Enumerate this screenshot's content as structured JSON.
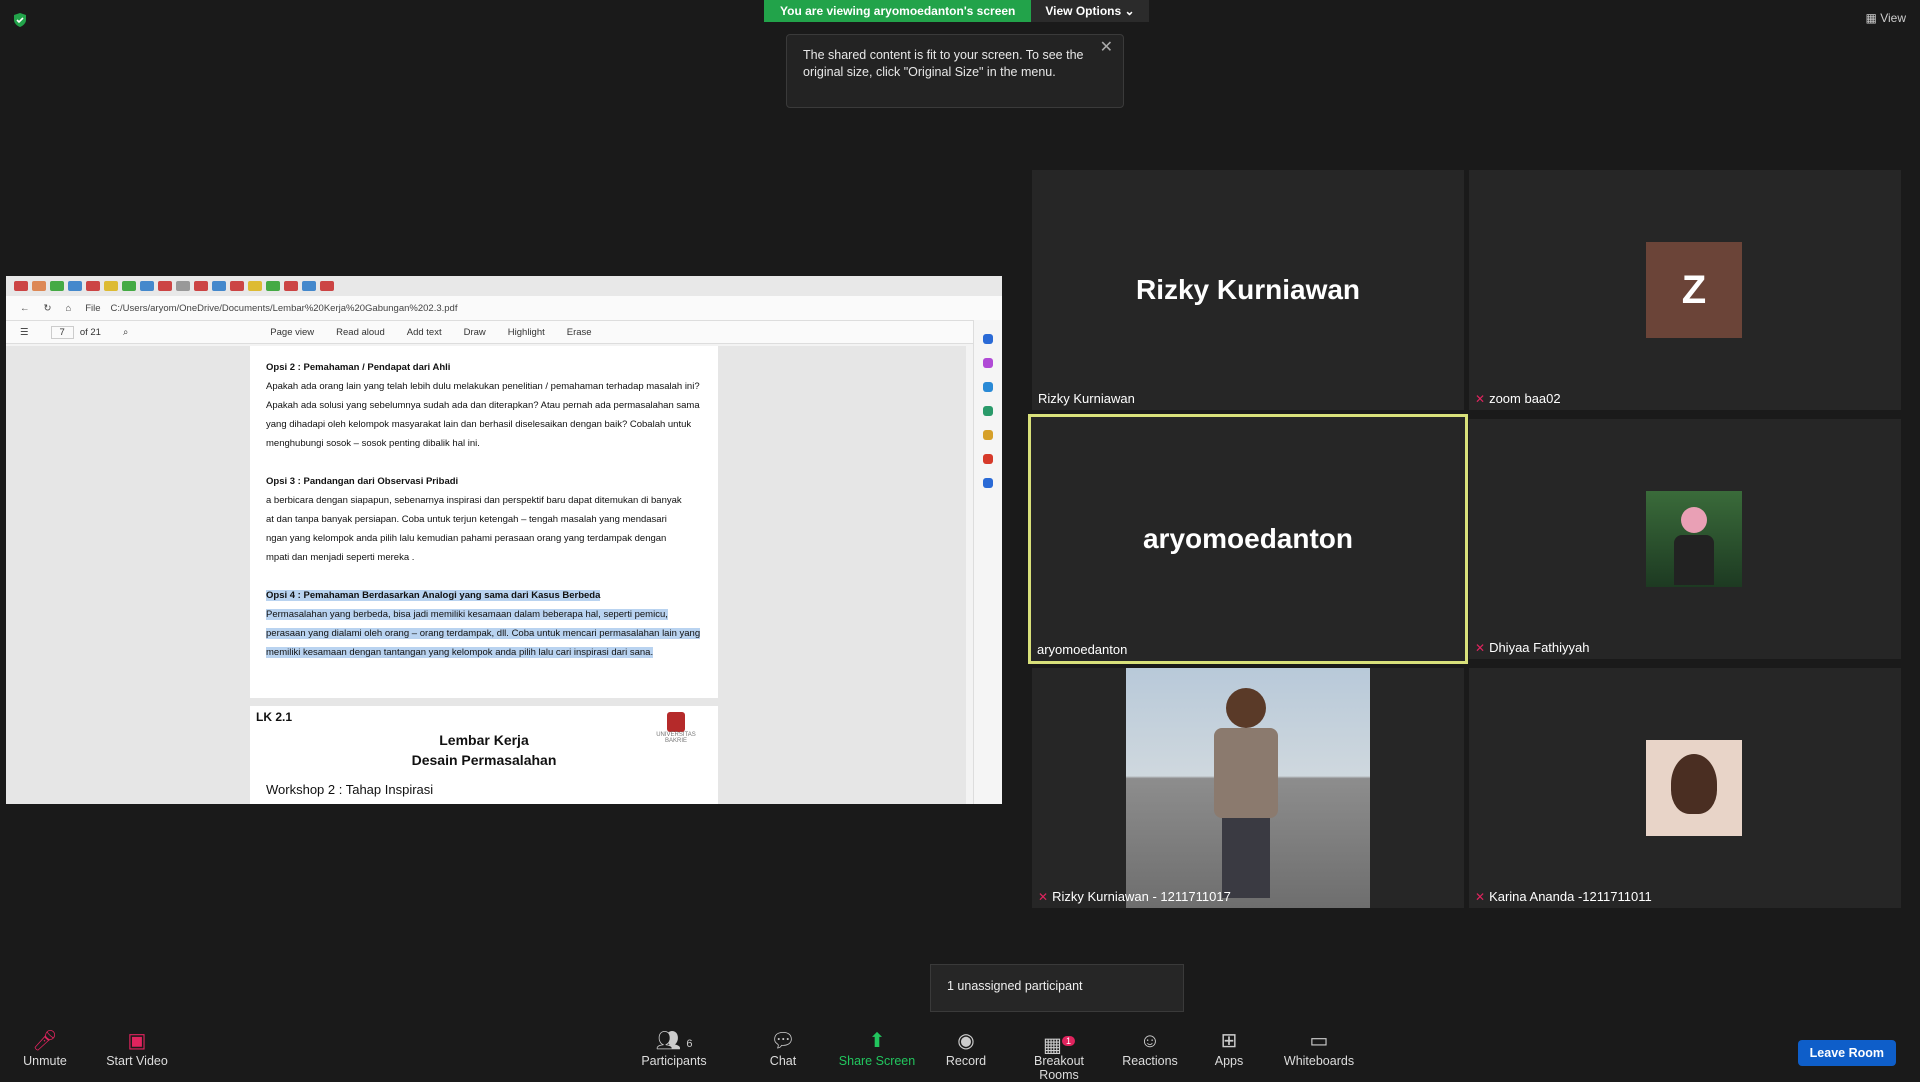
{
  "banner": {
    "viewing": "You are viewing aryomoedanton's screen",
    "view_options": "View Options"
  },
  "tooltip": {
    "text": "The shared content is fit to your screen. To see the original size, click \"Original Size\" in the menu."
  },
  "view": "View",
  "browser": {
    "path": "C:/Users/aryom/OneDrive/Documents/Lembar%20Kerja%20Gabungan%202.3.pdf",
    "file_label": "File",
    "page_current": "7",
    "page_total": "of 21",
    "tools": [
      "Page view",
      "Read aloud",
      "Add text",
      "Draw",
      "Highlight",
      "Erase"
    ]
  },
  "pdf": {
    "opsi2_title": "Opsi 2 : Pemahaman / Pendapat dari Ahli",
    "opsi2_lines": [
      "Apakah ada orang lain yang telah lebih dulu melakukan penelitian / pemahaman terhadap masalah ini?",
      "Apakah ada solusi yang sebelumnya sudah ada dan diterapkan? Atau pernah ada permasalahan sama",
      "yang dihadapi oleh kelompok masyarakat lain dan berhasil diselesaikan dengan baik? Cobalah untuk",
      "menghubungi sosok – sosok penting dibalik hal ini."
    ],
    "opsi3_title": "Opsi 3 : Pandangan dari Observasi Pribadi",
    "opsi3_lines": [
      "a berbicara dengan siapapun, sebenarnya inspirasi dan perspektif baru dapat ditemukan di banyak",
      "at dan tanpa banyak persiapan. Coba untuk terjun ketengah – tengah masalah yang mendasari",
      "ngan yang kelompok anda pilih lalu kemudian pahami perasaan orang yang terdampak dengan",
      "mpati dan menjadi seperti mereka ."
    ],
    "opsi4_title": "Opsi 4 : Pemahaman Berdasarkan Analogi yang sama dari Kasus Berbeda",
    "opsi4_lines": [
      "Permasalahan yang berbeda, bisa jadi memiliki kesamaan dalam beberapa hal, seperti pemicu,",
      "perasaan yang dialami oleh orang – orang terdampak, dll. Coba untuk mencari permasalahan lain yang",
      "memiliki kesamaan dengan tantangan yang kelompok anda pilih lalu cari inspirasi dari sana."
    ],
    "lk": "LK 2.1",
    "page2_title1": "Lembar Kerja",
    "page2_title2": "Desain Permasalahan",
    "page2_sub": "Workshop 2 : Tahap Inspirasi",
    "logo_text": "UNIVERSITAS BAKRIE"
  },
  "participants": [
    {
      "display": "Rizky Kurniawan",
      "label": "Rizky Kurniawan",
      "muted": false
    },
    {
      "display": "Z",
      "label": "zoom baa02",
      "muted": true
    },
    {
      "display": "aryomoedanton",
      "label": "aryomoedanton",
      "muted": false
    },
    {
      "display": "",
      "label": "Dhiyaa Fathiyyah",
      "muted": true
    },
    {
      "display": "",
      "label": "Rizky Kurniawan - 1211711017",
      "muted": true
    },
    {
      "display": "",
      "label": "Karina Ananda -1211711011",
      "muted": true
    }
  ],
  "unassigned": "1 unassigned participant",
  "toolbar": {
    "unmute": "Unmute",
    "start_video": "Start Video",
    "participants": "Participants",
    "participants_count": "6",
    "chat": "Chat",
    "share": "Share Screen",
    "record": "Record",
    "breakout": "Breakout Rooms",
    "breakout_badge": "1",
    "reactions": "Reactions",
    "apps": "Apps",
    "whiteboards": "Whiteboards",
    "leave": "Leave Room"
  }
}
